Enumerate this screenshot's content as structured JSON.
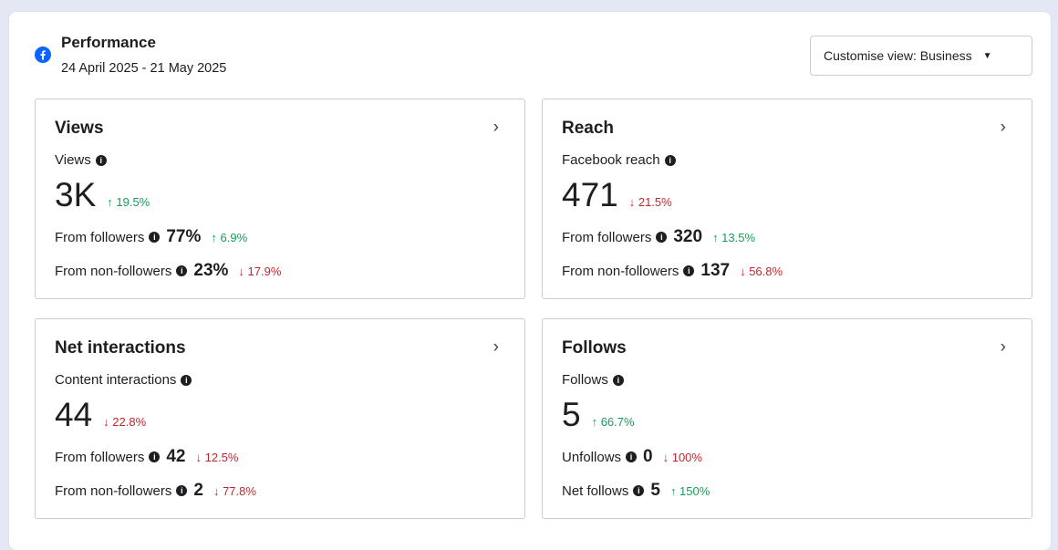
{
  "header": {
    "title": "Performance",
    "date_range": "24 April 2025 - 21 May 2025",
    "customise_label": "Customise view: Business",
    "caret_glyph": "▼"
  },
  "cards": [
    {
      "title": "Views",
      "metric_label": "Views",
      "value": "3K",
      "change": "↑ 19.5%",
      "change_dir": "up",
      "rows": [
        {
          "label": "From followers",
          "value": "77%",
          "change": "↑ 6.9%",
          "dir": "up"
        },
        {
          "label": "From non-followers",
          "value": "23%",
          "change": "↓ 17.9%",
          "dir": "down"
        }
      ]
    },
    {
      "title": "Reach",
      "metric_label": "Facebook reach",
      "value": "471",
      "change": "↓ 21.5%",
      "change_dir": "down",
      "rows": [
        {
          "label": "From followers",
          "value": "320",
          "change": "↑ 13.5%",
          "dir": "up"
        },
        {
          "label": "From non-followers",
          "value": "137",
          "change": "↓ 56.8%",
          "dir": "down"
        }
      ]
    },
    {
      "title": "Net interactions",
      "metric_label": "Content interactions",
      "value": "44",
      "change": "↓ 22.8%",
      "change_dir": "down",
      "rows": [
        {
          "label": "From followers",
          "value": "42",
          "change": "↓ 12.5%",
          "dir": "down"
        },
        {
          "label": "From non-followers",
          "value": "2",
          "change": "↓ 77.8%",
          "dir": "down"
        }
      ]
    },
    {
      "title": "Follows",
      "metric_label": "Follows",
      "value": "5",
      "change": "↑ 66.7%",
      "change_dir": "up",
      "rows": [
        {
          "label": "Unfollows",
          "value": "0",
          "change": "↓ 100%",
          "dir": "down"
        },
        {
          "label": "Net follows",
          "value": "5",
          "change": "↑ 150%",
          "dir": "up"
        }
      ]
    }
  ],
  "icons": {
    "facebook": "facebook-icon",
    "info": "info-icon",
    "chevron": "chevron-right-icon"
  },
  "colors": {
    "up": "#1a9c58",
    "down": "#c0272d",
    "facebook_blue": "#0866ff",
    "background": "#e4e8f5"
  }
}
